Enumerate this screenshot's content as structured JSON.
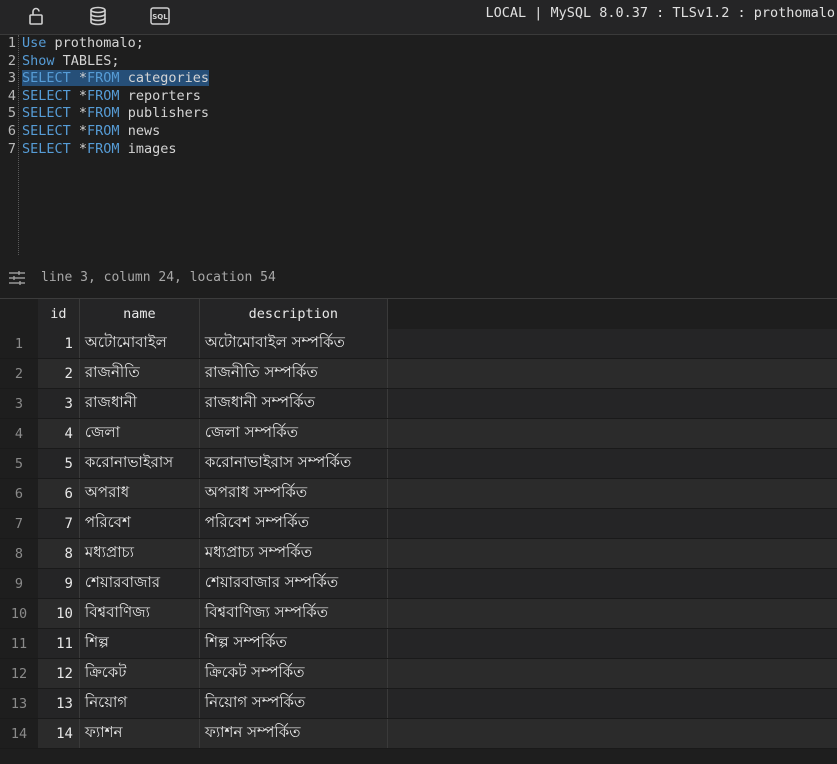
{
  "toolbar": {
    "icons": [
      "lock-icon",
      "database-icon",
      "sql-icon"
    ],
    "sql_label": "SQL",
    "connection": "LOCAL | MySQL 8.0.37 : TLSv1.2 : prothomalo"
  },
  "editor": {
    "lines": [
      {
        "n": "1",
        "kw1": "Use",
        "rest": " prothomalo;"
      },
      {
        "n": "2",
        "kw1": "Show",
        "rest": " TABLES;"
      },
      {
        "n": "3",
        "kw1": "SELECT",
        "mid": " *",
        "kw2": "FROM",
        "rest": " categories"
      },
      {
        "n": "4",
        "kw1": "SELECT",
        "mid": " *",
        "kw2": "FROM",
        "rest": " reporters"
      },
      {
        "n": "5",
        "kw1": "SELECT",
        "mid": " *",
        "kw2": "FROM",
        "rest": " publishers"
      },
      {
        "n": "6",
        "kw1": "SELECT",
        "mid": " *",
        "kw2": "FROM",
        "rest": " news"
      },
      {
        "n": "7",
        "kw1": "SELECT",
        "mid": " *",
        "kw2": "FROM",
        "rest": " images"
      }
    ]
  },
  "status": {
    "position": "line 3, column 24, location 54"
  },
  "grid": {
    "columns": [
      "id",
      "name",
      "description"
    ],
    "rows": [
      {
        "rn": "1",
        "id": "1",
        "name": "অটোমোবাইল",
        "description": "অটোমোবাইল সম্পর্কিত"
      },
      {
        "rn": "2",
        "id": "2",
        "name": "রাজনীতি",
        "description": "রাজনীতি সম্পর্কিত"
      },
      {
        "rn": "3",
        "id": "3",
        "name": "রাজধানী",
        "description": "রাজধানী সম্পর্কিত"
      },
      {
        "rn": "4",
        "id": "4",
        "name": "জেলা",
        "description": "জেলা সম্পর্কিত"
      },
      {
        "rn": "5",
        "id": "5",
        "name": "করোনাভাইরাস",
        "description": "করোনাভাইরাস সম্পর্কিত"
      },
      {
        "rn": "6",
        "id": "6",
        "name": "অপরাধ",
        "description": "অপরাধ সম্পর্কিত"
      },
      {
        "rn": "7",
        "id": "7",
        "name": "পরিবেশ",
        "description": "পরিবেশ সম্পর্কিত"
      },
      {
        "rn": "8",
        "id": "8",
        "name": "মধ্যপ্রাচ্য",
        "description": "মধ্যপ্রাচ্য সম্পর্কিত"
      },
      {
        "rn": "9",
        "id": "9",
        "name": "শেয়ারবাজার",
        "description": "শেয়ারবাজার সম্পর্কিত"
      },
      {
        "rn": "10",
        "id": "10",
        "name": "বিশ্ববাণিজ্য",
        "description": "বিশ্ববাণিজ্য সম্পর্কিত"
      },
      {
        "rn": "11",
        "id": "11",
        "name": "শিল্প",
        "description": "শিল্প সম্পর্কিত"
      },
      {
        "rn": "12",
        "id": "12",
        "name": "ক্রিকেট",
        "description": "ক্রিকেট সম্পর্কিত"
      },
      {
        "rn": "13",
        "id": "13",
        "name": "নিয়োগ",
        "description": "নিয়োগ সম্পর্কিত"
      },
      {
        "rn": "14",
        "id": "14",
        "name": "ফ্যাশন",
        "description": "ফ্যাশন সম্পর্কিত"
      }
    ]
  },
  "colors": {
    "keyword": "#569cd6",
    "selection": "#264f78",
    "background": "#1e1e1e"
  }
}
